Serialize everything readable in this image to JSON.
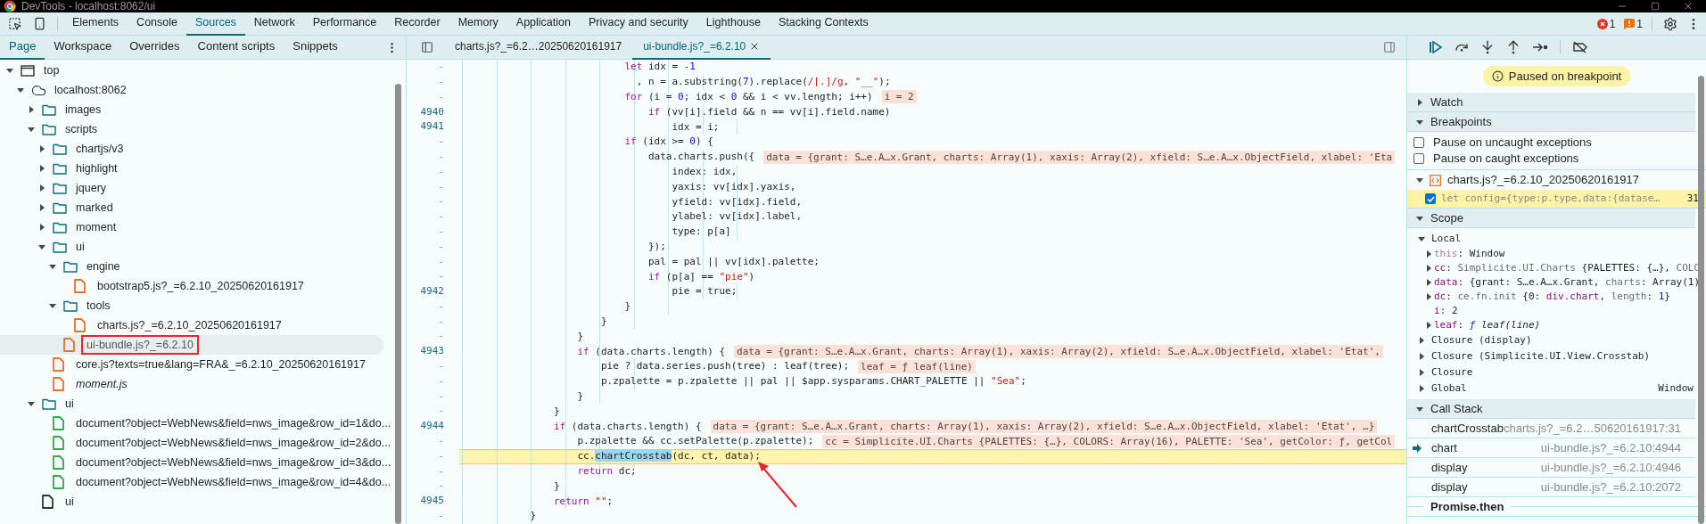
{
  "window": {
    "title": "DevTools - localhost:8062/ui"
  },
  "main_tabs": [
    {
      "label": "Elements",
      "selected": false
    },
    {
      "label": "Console",
      "selected": false
    },
    {
      "label": "Sources",
      "selected": true
    },
    {
      "label": "Network",
      "selected": false
    },
    {
      "label": "Performance",
      "selected": false
    },
    {
      "label": "Recorder",
      "selected": false
    },
    {
      "label": "Memory",
      "selected": false
    },
    {
      "label": "Application",
      "selected": false
    },
    {
      "label": "Privacy and security",
      "selected": false
    },
    {
      "label": "Lighthouse",
      "selected": false
    },
    {
      "label": "Stacking Contexts",
      "selected": false
    }
  ],
  "status_badges": {
    "errors": "1",
    "warnings": "1"
  },
  "navigator": {
    "tabs": [
      {
        "label": "Page",
        "selected": true
      },
      {
        "label": "Workspace",
        "selected": false
      },
      {
        "label": "Overrides",
        "selected": false
      },
      {
        "label": "Content scripts",
        "selected": false
      },
      {
        "label": "Snippets",
        "selected": false
      }
    ],
    "tree": [
      {
        "label": "top",
        "kind": "frame",
        "expanded": true,
        "children": [
          {
            "label": "localhost:8062",
            "kind": "origin",
            "expanded": true,
            "children": [
              {
                "label": "images",
                "kind": "folder",
                "expanded": false
              },
              {
                "label": "scripts",
                "kind": "folder",
                "expanded": true,
                "children": [
                  {
                    "label": "chartjs/v3",
                    "kind": "folder",
                    "expanded": false
                  },
                  {
                    "label": "highlight",
                    "kind": "folder",
                    "expanded": false
                  },
                  {
                    "label": "jquery",
                    "kind": "folder",
                    "expanded": false
                  },
                  {
                    "label": "marked",
                    "kind": "folder",
                    "expanded": false
                  },
                  {
                    "label": "moment",
                    "kind": "folder",
                    "expanded": false
                  },
                  {
                    "label": "ui",
                    "kind": "folder",
                    "expanded": true,
                    "children": [
                      {
                        "label": "engine",
                        "kind": "folder",
                        "expanded": true,
                        "children": [
                          {
                            "label": "bootstrap5.js?_=6.2.10_20250620161917",
                            "kind": "file",
                            "color": "#e8702a",
                            "selected": false,
                            "italic": false
                          }
                        ]
                      },
                      {
                        "label": "tools",
                        "kind": "folder",
                        "expanded": true,
                        "children": [
                          {
                            "label": "charts.js?_=6.2.10_20250620161917",
                            "kind": "file",
                            "color": "#e8702a",
                            "selected": false,
                            "italic": false
                          }
                        ]
                      },
                      {
                        "label": "ui-bundle.js?_=6.2.10",
                        "kind": "file",
                        "color": "#e8702a",
                        "selected": true,
                        "italic": false
                      }
                    ]
                  },
                  {
                    "label": "core.js?texts=true&lang=FRA&_=6.2.10_20250620161917",
                    "kind": "file",
                    "color": "#e8702a",
                    "selected": false,
                    "italic": false
                  },
                  {
                    "label": "moment.js",
                    "kind": "file",
                    "color": "#e8702a",
                    "selected": false,
                    "italic": true
                  }
                ]
              },
              {
                "label": "ui",
                "kind": "folder",
                "expanded": true,
                "children": [
                  {
                    "label": "document?object=WebNews&field=nws_image&row_id=1&do...",
                    "kind": "file",
                    "color": "#2fa84f",
                    "selected": false,
                    "italic": false
                  },
                  {
                    "label": "document?object=WebNews&field=nws_image&row_id=2&do...",
                    "kind": "file",
                    "color": "#2fa84f",
                    "selected": false,
                    "italic": false
                  },
                  {
                    "label": "document?object=WebNews&field=nws_image&row_id=3&do...",
                    "kind": "file",
                    "color": "#2fa84f",
                    "selected": false,
                    "italic": false
                  },
                  {
                    "label": "document?object=WebNews&field=nws_image&row_id=4&do...",
                    "kind": "file",
                    "color": "#2fa84f",
                    "selected": false,
                    "italic": false
                  }
                ]
              },
              {
                "label": "ui",
                "kind": "file",
                "color": "#333333",
                "selected": false,
                "italic": false
              }
            ]
          }
        ]
      }
    ]
  },
  "editor": {
    "tabs": [
      {
        "label": "charts.js?_=6.2…20250620161917",
        "selected": false,
        "closable": false
      },
      {
        "label": "ui-bundle.js?_=6.2.10",
        "selected": true,
        "closable": true
      }
    ],
    "lines": [
      {
        "number": "-",
        "paused": false,
        "segments": [
          {
            "kind": "keyword",
            "text": "                            let"
          },
          {
            "kind": "plain",
            "text": " idx = "
          },
          {
            "kind": "number",
            "text": "-1"
          }
        ]
      },
      {
        "number": "-",
        "paused": false,
        "segments": [
          {
            "kind": "plain",
            "text": "                              , n = a.substring("
          },
          {
            "kind": "number",
            "text": "7"
          },
          {
            "kind": "plain",
            "text": ").replace("
          },
          {
            "kind": "regex",
            "text": "/[.]/g"
          },
          {
            "kind": "plain",
            "text": ", "
          },
          {
            "kind": "string",
            "text": "\"__\""
          },
          {
            "kind": "plain",
            "text": ");"
          }
        ]
      },
      {
        "number": "-",
        "paused": false,
        "segments": [
          {
            "kind": "keyword",
            "text": "                            for"
          },
          {
            "kind": "plain",
            "text": " (i = "
          },
          {
            "kind": "number",
            "text": "0"
          },
          {
            "kind": "plain",
            "text": "; idx < "
          },
          {
            "kind": "number",
            "text": "0"
          },
          {
            "kind": "plain",
            "text": " && i < vv.length; i++)"
          }
        ],
        "inline_value": "i = 2"
      },
      {
        "number": "4940",
        "paused": false,
        "segments": [
          {
            "kind": "keyword",
            "text": "                                if"
          },
          {
            "kind": "plain",
            "text": " (vv[i].field && n == vv[i].field.name)"
          }
        ]
      },
      {
        "number": "4941",
        "paused": false,
        "segments": [
          {
            "kind": "plain",
            "text": "                                    idx = i;"
          }
        ]
      },
      {
        "number": "-",
        "paused": false,
        "segments": [
          {
            "kind": "keyword",
            "text": "                            if"
          },
          {
            "kind": "plain",
            "text": " (idx >= "
          },
          {
            "kind": "number",
            "text": "0"
          },
          {
            "kind": "plain",
            "text": ") {"
          }
        ]
      },
      {
        "number": "-",
        "paused": false,
        "segments": [
          {
            "kind": "plain",
            "text": "                                data.charts.push({"
          }
        ],
        "inline_value": "data = {grant: S…e.A…x.Grant, charts: Array(1), xaxis: Array(2), xfield: S…e.A…x.ObjectField, xlabel: 'Eta"
      },
      {
        "number": "-",
        "paused": false,
        "segments": [
          {
            "kind": "plain",
            "text": "                                    index: idx,"
          }
        ]
      },
      {
        "number": "-",
        "paused": false,
        "segments": [
          {
            "kind": "plain",
            "text": "                                    yaxis: vv[idx].yaxis,"
          }
        ]
      },
      {
        "number": "-",
        "paused": false,
        "segments": [
          {
            "kind": "plain",
            "text": "                                    yfield: vv[idx].field,"
          }
        ]
      },
      {
        "number": "-",
        "paused": false,
        "segments": [
          {
            "kind": "plain",
            "text": "                                    ylabel: vv[idx].label,"
          }
        ]
      },
      {
        "number": "-",
        "paused": false,
        "segments": [
          {
            "kind": "plain",
            "text": "                                    type: p[a]"
          }
        ]
      },
      {
        "number": "-",
        "paused": false,
        "segments": [
          {
            "kind": "plain",
            "text": "                                });"
          }
        ]
      },
      {
        "number": "-",
        "paused": false,
        "segments": [
          {
            "kind": "plain",
            "text": "                                pal = pal || vv[idx].palette;"
          }
        ]
      },
      {
        "number": "-",
        "paused": false,
        "segments": [
          {
            "kind": "keyword",
            "text": "                                if"
          },
          {
            "kind": "plain",
            "text": " (p[a] == "
          },
          {
            "kind": "string",
            "text": "\"pie\""
          },
          {
            "kind": "plain",
            "text": ")"
          }
        ]
      },
      {
        "number": "4942",
        "paused": false,
        "segments": [
          {
            "kind": "plain",
            "text": "                                    pie = true;"
          }
        ]
      },
      {
        "number": "-",
        "paused": false,
        "segments": [
          {
            "kind": "plain",
            "text": "                            }"
          }
        ]
      },
      {
        "number": "-",
        "paused": false,
        "segments": [
          {
            "kind": "plain",
            "text": "                        }"
          }
        ]
      },
      {
        "number": "-",
        "paused": false,
        "segments": [
          {
            "kind": "plain",
            "text": "                    }"
          }
        ]
      },
      {
        "number": "4943",
        "paused": false,
        "segments": [
          {
            "kind": "keyword",
            "text": "                    if"
          },
          {
            "kind": "plain",
            "text": " (data.charts.length) {"
          }
        ],
        "inline_value": "data = {grant: S…e.A…x.Grant, charts: Array(1), xaxis: Array(2), xfield: S…e.A…x.ObjectField, xlabel: 'Etat',"
      },
      {
        "number": "-",
        "paused": false,
        "segments": [
          {
            "kind": "plain",
            "text": "                        pie ? data.series.push(tree) : leaf(tree);"
          }
        ],
        "inline_value": "leaf = ƒ leaf(line)"
      },
      {
        "number": "-",
        "paused": false,
        "segments": [
          {
            "kind": "plain",
            "text": "                        p.zpalette = p.zpalette || pal || $app.sysparams.CHART_PALETTE || "
          },
          {
            "kind": "string",
            "text": "\"Sea\""
          },
          {
            "kind": "plain",
            "text": ";"
          }
        ]
      },
      {
        "number": "-",
        "paused": false,
        "segments": [
          {
            "kind": "plain",
            "text": "                    }"
          }
        ]
      },
      {
        "number": "-",
        "paused": false,
        "segments": [
          {
            "kind": "plain",
            "text": "                }"
          }
        ]
      },
      {
        "number": "4944",
        "paused": false,
        "segments": [
          {
            "kind": "keyword",
            "text": "                if"
          },
          {
            "kind": "plain",
            "text": " (data.charts.length) {"
          }
        ],
        "inline_value": "data = {grant: S…e.A…x.Grant, charts: Array(1), xaxis: Array(2), xfield: S…e.A…x.ObjectField, xlabel: 'Etat', …}"
      },
      {
        "number": "-",
        "paused": false,
        "segments": [
          {
            "kind": "plain",
            "text": "                    p.zpalette && cc.setPalette(p.zpalette);"
          }
        ],
        "inline_value": "cc = Simplicite.UI.Charts {PALETTES: {…}, COLORS: Array(16), PALETTE: 'Sea', getColor: ƒ, getCol"
      },
      {
        "number": "-",
        "paused": true,
        "segments": [
          {
            "kind": "plain",
            "text": "                    cc."
          },
          {
            "kind": "highlight",
            "text": "chartCrosstab"
          },
          {
            "kind": "plain",
            "text": "(dc, ct, data);"
          }
        ]
      },
      {
        "number": "-",
        "paused": false,
        "segments": [
          {
            "kind": "keyword",
            "text": "                    return"
          },
          {
            "kind": "plain",
            "text": " dc;"
          }
        ]
      },
      {
        "number": "-",
        "paused": false,
        "segments": [
          {
            "kind": "plain",
            "text": "                }"
          }
        ]
      },
      {
        "number": "4945",
        "paused": false,
        "segments": [
          {
            "kind": "keyword",
            "text": "                return"
          },
          {
            "kind": "string",
            "text": " \"\""
          },
          {
            "kind": "plain",
            "text": ";"
          }
        ]
      },
      {
        "number": "-",
        "paused": false,
        "segments": [
          {
            "kind": "plain",
            "text": "            }"
          }
        ]
      }
    ]
  },
  "debugger": {
    "status": "Paused on breakpoint",
    "watch": {
      "title": "Watch",
      "expanded": false
    },
    "breakpoints": {
      "title": "Breakpoints",
      "expanded": true,
      "options": [
        {
          "label": "Pause on uncaught exceptions",
          "checked": false
        },
        {
          "label": "Pause on caught exceptions",
          "checked": false
        }
      ],
      "files": [
        {
          "name": "charts.js?_=6.2.10_20250620161917",
          "expanded": true,
          "breakpoints": [
            {
              "code": "let config={type:p.type,data:{datase…",
              "line": "31",
              "enabled": true,
              "hit": true
            }
          ]
        }
      ]
    },
    "scope": {
      "title": "Scope",
      "expanded": true,
      "groups": [
        {
          "label": "Local",
          "expanded": true,
          "variables": [
            {
              "name": "this",
              "dimmed": true,
              "expandable": true,
              "value": [
                {
                  "kind": "plain",
                  "text": ": Window"
                }
              ]
            },
            {
              "name": "cc",
              "dimmed": false,
              "expandable": true,
              "value": [
                {
                  "kind": "plain",
                  "text": ": "
                },
                {
                  "kind": "dim",
                  "text": "Simplicite.UI.Charts "
                },
                {
                  "kind": "plain",
                  "text": "{PALETTES: {…}, "
                },
                {
                  "kind": "dim",
                  "text": "COLO"
                }
              ]
            },
            {
              "name": "data",
              "dimmed": false,
              "expandable": true,
              "value": [
                {
                  "kind": "plain",
                  "text": ": {grant: S…e.A…x.Grant, "
                },
                {
                  "kind": "dim",
                  "text": "charts"
                },
                {
                  "kind": "plain",
                  "text": ": Array(1)"
                }
              ]
            },
            {
              "name": "dc",
              "dimmed": false,
              "expandable": true,
              "value": [
                {
                  "kind": "plain",
                  "text": ": "
                },
                {
                  "kind": "dim",
                  "text": "ce.fn.init "
                },
                {
                  "kind": "plain",
                  "text": "{0: "
                },
                {
                  "kind": "accent",
                  "text": "div.chart"
                },
                {
                  "kind": "plain",
                  "text": ", "
                },
                {
                  "kind": "dim",
                  "text": "length"
                },
                {
                  "kind": "plain",
                  "text": ": "
                },
                {
                  "kind": "number",
                  "text": "1"
                },
                {
                  "kind": "plain",
                  "text": "}"
                }
              ]
            },
            {
              "name": "i",
              "dimmed": false,
              "expandable": false,
              "value": [
                {
                  "kind": "plain",
                  "text": ": "
                },
                {
                  "kind": "number",
                  "text": "2"
                }
              ]
            },
            {
              "name": "leaf",
              "dimmed": false,
              "expandable": true,
              "value": [
                {
                  "kind": "plain",
                  "text": ": "
                },
                {
                  "kind": "func",
                  "text": "ƒ "
                },
                {
                  "kind": "italic",
                  "text": "leaf(line)"
                }
              ]
            }
          ]
        },
        {
          "label": "Closure (display)",
          "expanded": false
        },
        {
          "label": "Closure (Simplicite.UI.View.Crosstab)",
          "expanded": false
        },
        {
          "label": "Closure",
          "expanded": false
        },
        {
          "label": "Global",
          "value": "Window",
          "expanded": false
        }
      ]
    },
    "call_stack": {
      "title": "Call Stack",
      "expanded": true,
      "frames": [
        {
          "kind": "frame",
          "function": "chartCrosstab",
          "location": "charts.js?_=6.2…50620161917:31",
          "current": false
        },
        {
          "kind": "frame",
          "function": "chart",
          "location": "ui-bundle.js?_=6.2.10:4944",
          "current": true
        },
        {
          "kind": "frame",
          "function": "display",
          "location": "ui-bundle.js?_=6.2.10:4946",
          "current": false
        },
        {
          "kind": "frame",
          "function": "display",
          "location": "ui-bundle.js?_=6.2.10:2072",
          "current": false
        },
        {
          "kind": "async",
          "label": "Promise.then"
        }
      ]
    }
  }
}
